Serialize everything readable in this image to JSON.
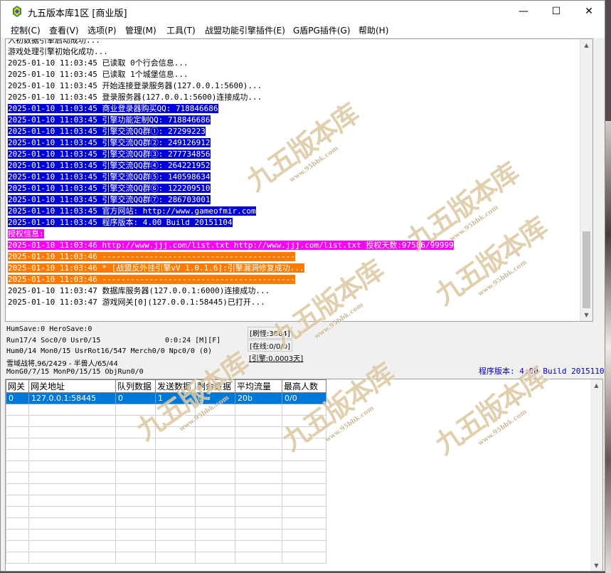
{
  "window": {
    "title": "九五版本库1区 [商业版]",
    "controls": {
      "minimize": "—",
      "maximize": "☐",
      "close": "✕"
    }
  },
  "menu": [
    "控制(C)",
    "查看(V)",
    "选项(P)",
    "管理(M)",
    "工具(T)",
    "战盟功能引擎插件(E)",
    "G盾PG插件(G)",
    "帮助(H)"
  ],
  "log": {
    "lines": [
      {
        "text": "入初数据引擎启动成功...",
        "style": "normal"
      },
      {
        "text": "游戏处理引擎初始化成功...",
        "style": "normal"
      },
      {
        "text": "2025-01-10 11:03:45 已读取 0个行会信息...",
        "style": "normal"
      },
      {
        "text": "2025-01-10 11:03:45 已读取 1个城堡信息...",
        "style": "normal"
      },
      {
        "text": "2025-01-10 11:03:45 开始连接登录服务器(127.0.0.1:5600)...",
        "style": "normal"
      },
      {
        "text": "2025-01-10 11:03:45 登录服务器(127.0.0.1:5600)连接成功...",
        "style": "normal"
      },
      {
        "text": "2025-01-10 11:03:45 商业登录器购买QQ: 718846686",
        "style": "blue"
      },
      {
        "text": "2025-01-10 11:03:45 引擎功能定制QQ: 718846686",
        "style": "blue"
      },
      {
        "text": "2025-01-10 11:03:45 引擎交流QQ群①: 27299223",
        "style": "blue"
      },
      {
        "text": "2025-01-10 11:03:45 引擎交流QQ群②: 249126912",
        "style": "blue"
      },
      {
        "text": "2025-01-10 11:03:45 引擎交流QQ群③: 277734856",
        "style": "blue"
      },
      {
        "text": "2025-01-10 11:03:45 引擎交流QQ群④: 264221952",
        "style": "blue"
      },
      {
        "text": "2025-01-10 11:03:45 引擎交流QQ群⑤: 140598634",
        "style": "blue"
      },
      {
        "text": "2025-01-10 11:03:45 引擎交流QQ群⑥: 122209510",
        "style": "blue"
      },
      {
        "text": "2025-01-10 11:03:45 引擎交流QQ群⑦: 286703001",
        "style": "blue"
      },
      {
        "text": "2025-01-10 11:03:45 官方网站: http://www.gameofmir.com",
        "style": "blue"
      },
      {
        "text": "2025-01-10 11:03:45 程序版本: 4.00 Build 20151104",
        "style": "blue"
      },
      {
        "text": "授权信息:",
        "style": "magenta"
      },
      {
        "text": "2025-01-10 11:03:46 http://www.jjj.com/list.txt http://www.jjj.com/list.txt 授权天数:97586/99999",
        "style": "magenta"
      },
      {
        "text": "2025-01-10 11:03:46 -----------------------------------------",
        "style": "orange"
      },
      {
        "text": "2025-01-10 11:03:46 * [战盟反外挂引擎vV 1.0.1.6]:引擎漏洞修复成功...",
        "style": "orange"
      },
      {
        "text": "2025-01-10 11:03:46 -----------------------------------------",
        "style": "orange"
      },
      {
        "text": "2025-01-10 11:03:47 数据库服务器(127.0.0.1:6000)连接成功...",
        "style": "normal"
      },
      {
        "text": "2025-01-10 11:03:47 游戏网关[0](127.0.0.1:58445)已打开...",
        "style": "normal"
      }
    ]
  },
  "status": {
    "hum_save": "HumSave:0 HeroSave:0",
    "run": "Run17/4 Soc0/0 Usr0/15",
    "time": "0:0:24 [M][F]",
    "hum": "Hum0/14 Mon0/15 UsrRot16/547 Merch0/0 Npc0/0 (0)",
    "map": "雪域战将,96/2429 - 半兽人/65/44",
    "mon": "MonG0/7/15 MonP0/15/15 ObjRun0/0",
    "refresh_monster": "[刷怪:3664]",
    "online": "[在线:0/0/0]",
    "engine": "[引擎:0.0003天]",
    "version": "程序版本: 4.00 Build 20151104"
  },
  "gateway_table": {
    "columns": [
      "网关",
      "网关地址",
      "队列数据",
      "发送数据",
      "剩余数据",
      "平均流量",
      "最高人数"
    ],
    "rows": [
      [
        "0",
        "127.0.0.1:58445",
        "0",
        "1",
        "0",
        "20b",
        "0/0"
      ]
    ],
    "empty_rows": 14
  },
  "watermark": {
    "text": "九五版本库",
    "sub": "www.95bbk.com"
  }
}
